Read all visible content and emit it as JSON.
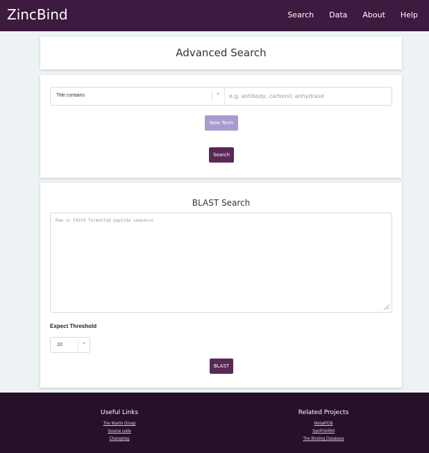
{
  "header": {
    "brand": "ZincBind",
    "nav": [
      "Search",
      "Data",
      "About",
      "Help"
    ]
  },
  "advanced": {
    "title": "Advanced Search",
    "term_select": "Title contains",
    "term_placeholder": "e.g. antibody, carbonic anhydrase",
    "new_term_label": "New Term",
    "search_label": "Search"
  },
  "blast": {
    "title": "BLAST Search",
    "sequence_placeholder": "Raw or FASTA formatted peptide sequence",
    "threshold_label": "Expect Threshold",
    "threshold_value": "10",
    "blast_label": "BLAST"
  },
  "footer": {
    "useful_title": "Useful Links",
    "useful_links": [
      "The Martin Group",
      "Source code",
      "Changelog"
    ],
    "related_title": "Related Projects",
    "related_links": [
      "MetalPDB",
      "SynPHARM",
      "The Binding Database"
    ]
  },
  "colors": {
    "nav_bg": "#3d1a3f",
    "footer_bg": "#26102b",
    "page_bg": "#edf2f4",
    "primary_button": "#5a2855",
    "secondary_button": "#a89bcf"
  },
  "icons": {
    "select_caret": "chevron-down-icon",
    "textarea_resize": "resize-grip-icon"
  }
}
